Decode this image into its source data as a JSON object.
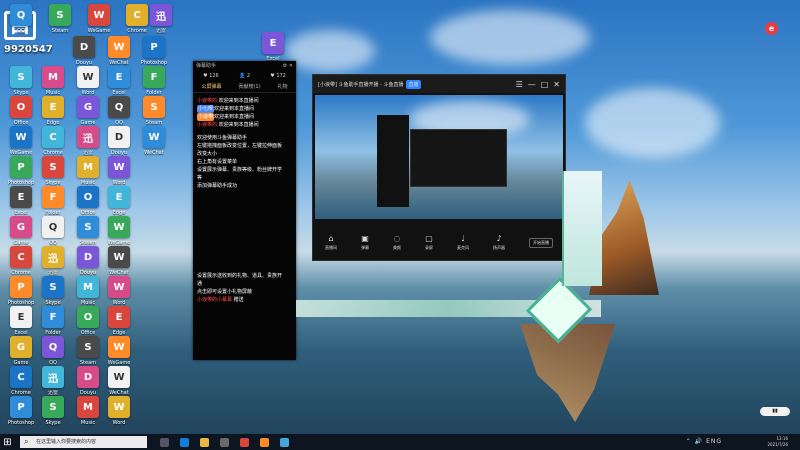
{
  "desktop": {
    "watermark_count": "9920547",
    "logo_char": "目",
    "red_dot": "e",
    "taskbar_search": "在这里输入你要搜索的内容",
    "tray_time": "13:16",
    "tray_date": "2021/7/26",
    "widget_text": "▮▮"
  },
  "chat": {
    "title": "弹幕助手",
    "stats": [
      "♥ 126",
      "👤 2",
      "♥ 172"
    ],
    "tabs": [
      "公屏弹幕",
      "贡献榜(1)",
      "礼物"
    ],
    "lines": [
      {
        "name": "小浪带的",
        "text": "欢迎来到本直播间",
        "type": "red"
      },
      {
        "name": "小七呀",
        "text": "欢迎来到本直播间",
        "type": "blue"
      },
      {
        "name": "小浪带",
        "text": "欢迎来到本直播间",
        "type": "orange"
      },
      {
        "name": "小浪带的",
        "text": "欢迎来到本直播间",
        "type": "red"
      },
      {
        "name": "",
        "text": "欢迎使用斗鱼弹幕助手",
        "type": "plain"
      },
      {
        "name": "",
        "text": "左键拖拽面板改变位置，左键拉伸面板",
        "type": "plain"
      },
      {
        "name": "",
        "text": "改变大小",
        "type": "plain"
      },
      {
        "name": "",
        "text": "右上角有设置菜单",
        "type": "plain"
      },
      {
        "name": "",
        "text": "设置展示弹幕、贵族等级、粉丝牌开学",
        "type": "plain"
      },
      {
        "name": "",
        "text": "等",
        "type": "plain"
      },
      {
        "name": "",
        "text": "添加弹幕助手成功",
        "type": "plain"
      },
      {
        "name": "",
        "text": "设置展示送收到的礼物、道具、贵族开",
        "type": "plain"
      },
      {
        "name": "",
        "text": "通",
        "type": "plain"
      },
      {
        "name": "",
        "text": "点击即可设置小礼物屏蔽",
        "type": "plain"
      },
      {
        "name": "小浪带的小幕幕",
        "text": "赠送",
        "type": "red"
      }
    ]
  },
  "obs": {
    "title": "[小浪带] 斗鱼助手直播开播 - 斗鱼直播",
    "badge": "直播",
    "toolbar": [
      "直播间",
      "弹幕",
      "美颜",
      "录屏",
      "麦克风",
      "扬声器"
    ],
    "start_live": "开始直播"
  },
  "desktop_labels": [
    "QQ",
    "Steam",
    "WeGame",
    "Chrome",
    "迅雷",
    "Douyu",
    "WeChat",
    "Photoshop",
    "Skype",
    "Music",
    "Word",
    "Excel",
    "Folder",
    "Office",
    "Edge",
    "Game"
  ]
}
